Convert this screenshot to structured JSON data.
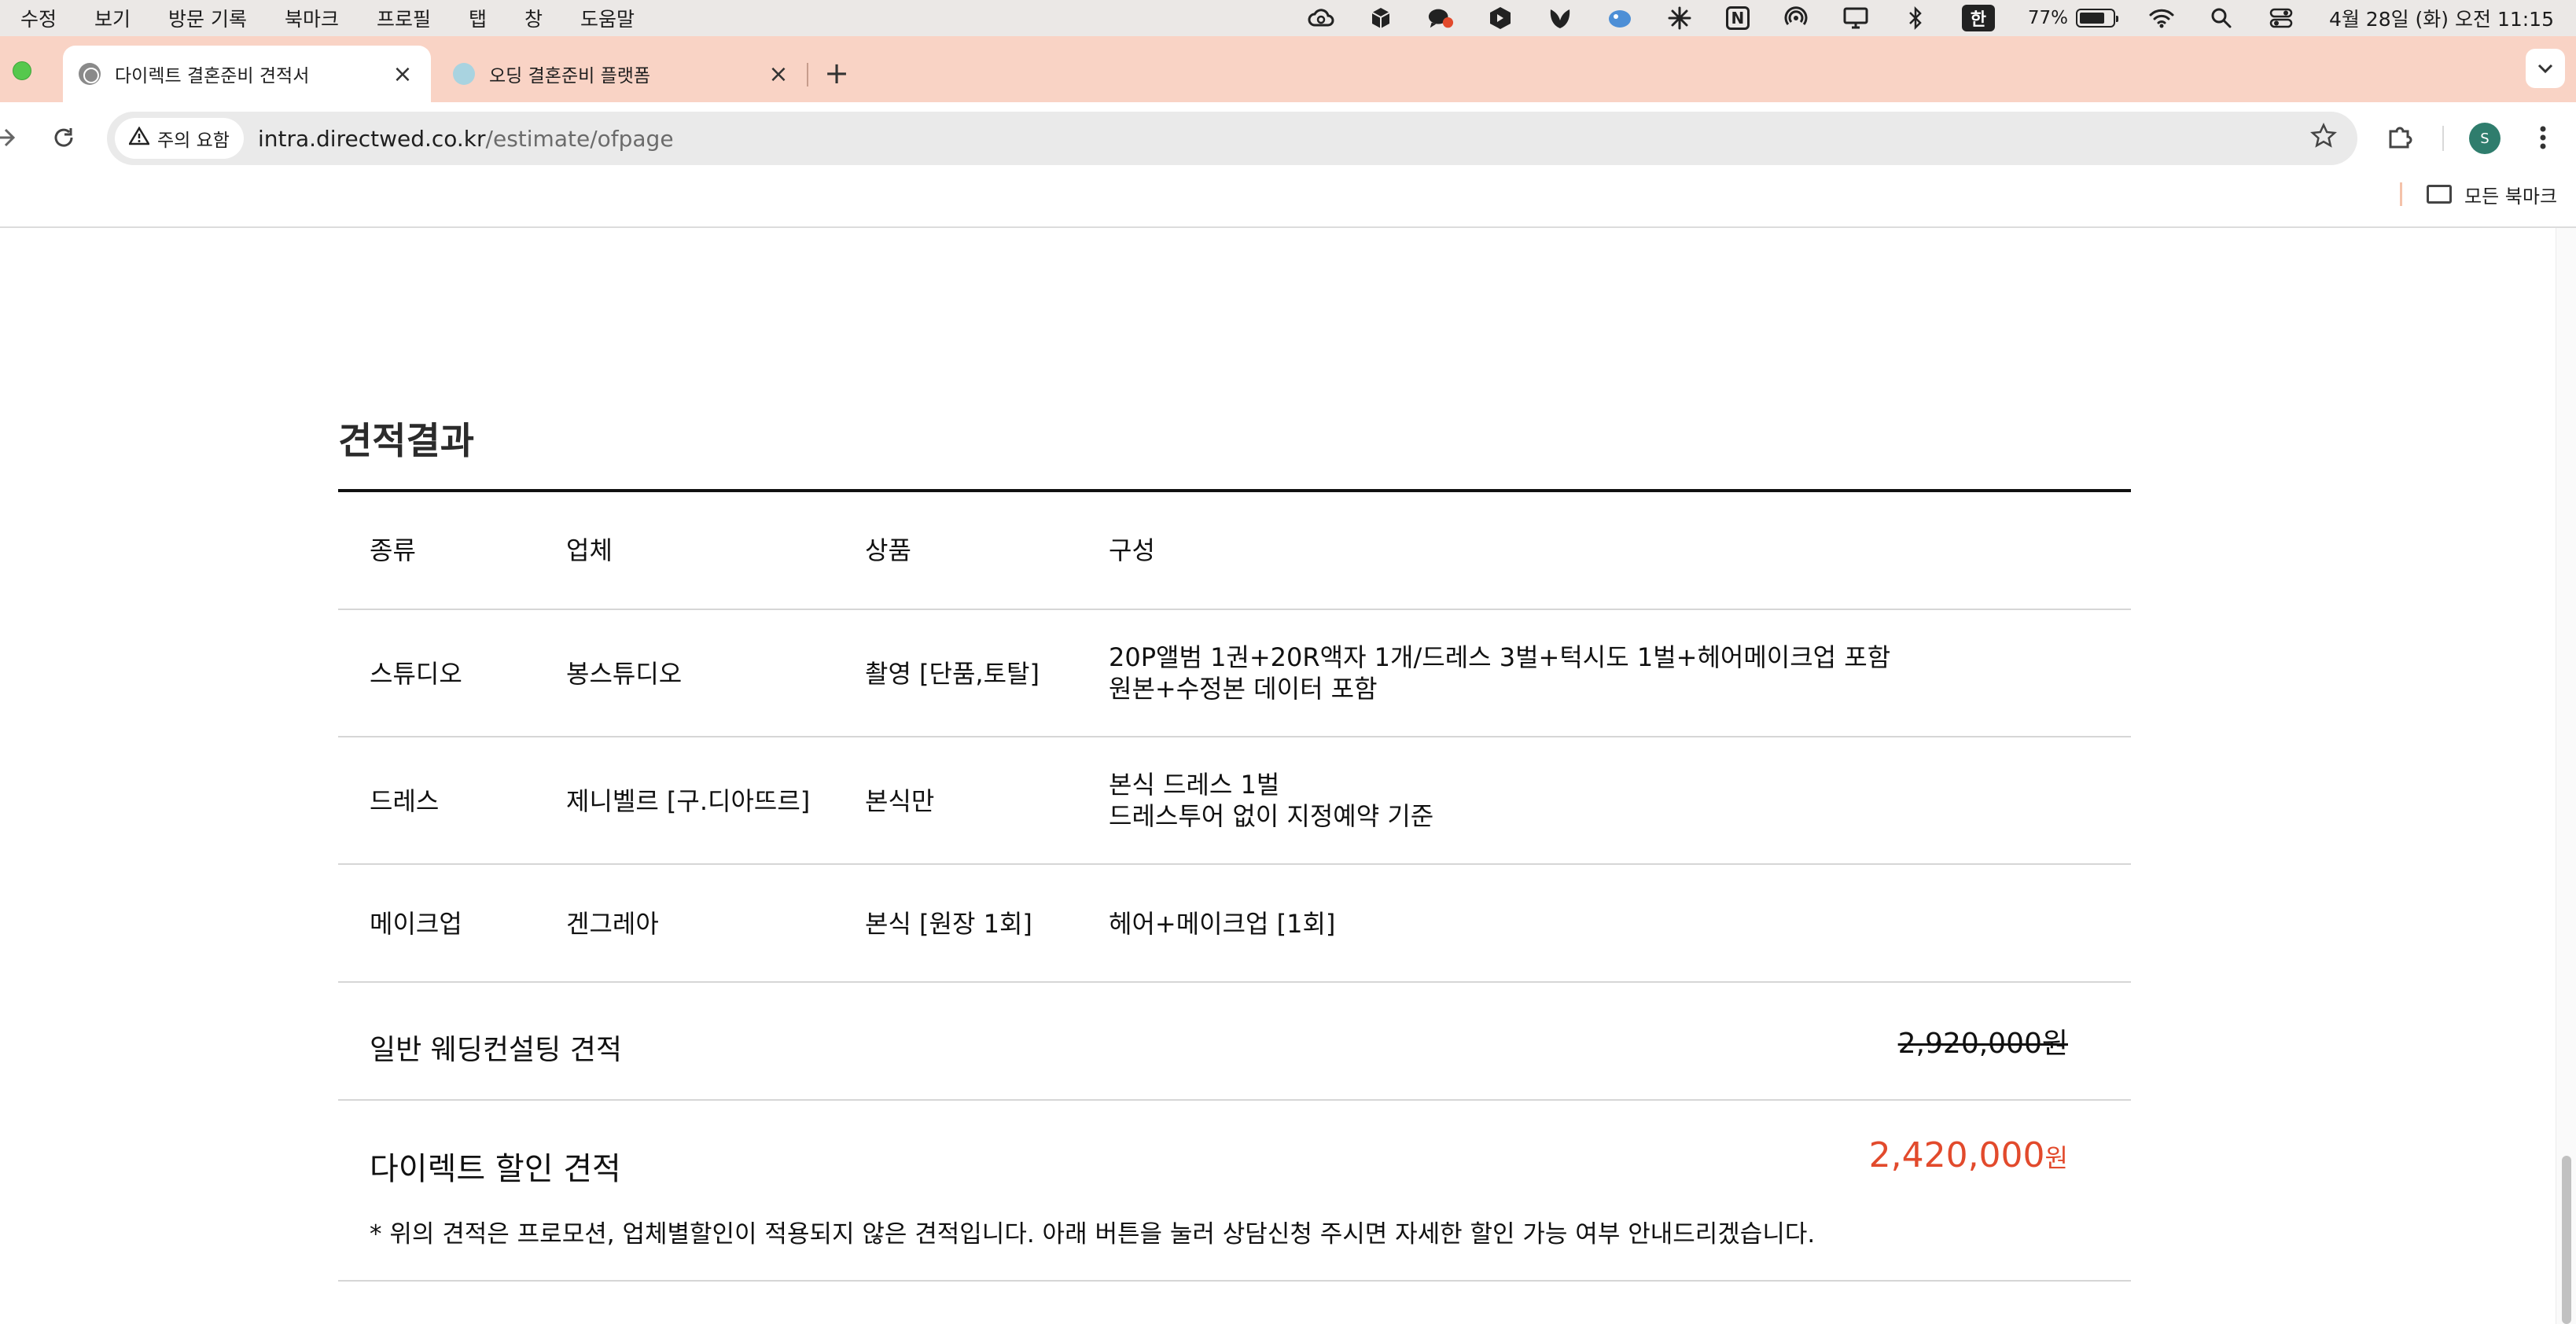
{
  "menubar": {
    "menus": [
      "수정",
      "보기",
      "방문 기록",
      "북마크",
      "프로필",
      "탭",
      "창",
      "도움말"
    ],
    "ime_label": "한",
    "notion_label": "N",
    "battery_pct": "77%",
    "battery_level": 0.77,
    "clock": "4월 28일 (화) 오전 11:15"
  },
  "tabs": [
    {
      "title": "다이렉트 결혼준비 견적서",
      "active": true
    },
    {
      "title": "오딩 결혼준비 플랫폼",
      "active": false
    }
  ],
  "toolbar": {
    "security_chip": "주의 요함",
    "url_host": "intra.directwed.co.kr",
    "url_path": "/estimate/ofpage",
    "avatar_initial": "S"
  },
  "bookmarks": {
    "all_bookmarks_label": "모든 북마크"
  },
  "estimate": {
    "title": "견적결과",
    "columns": [
      "종류",
      "업체",
      "상품",
      "구성"
    ],
    "rows": [
      {
        "type": "스튜디오",
        "vendor": "봉스튜디오",
        "product": "촬영 [단품,토탈]",
        "config_line1": "20P앨범 1권+20R액자 1개/드레스 3벌+턱시도 1벌+헤어메이크업 포함",
        "config_line2": "원본+수정본 데이터 포함"
      },
      {
        "type": "드레스",
        "vendor": "제니벨르 [구.디아뜨르]",
        "product": "본식만",
        "config_line1": "본식 드레스 1벌",
        "config_line2": "드레스투어 없이 지정예약 기준"
      },
      {
        "type": "메이크업",
        "vendor": "겐그레아",
        "product": "본식 [원장 1회]",
        "config_line1": "헤어+메이크업 [1회]",
        "config_line2": ""
      }
    ],
    "general_label": "일반 웨딩컨설팅 견적",
    "general_price": "2,920,000원",
    "discount_label": "다이렉트 할인 견적",
    "discount_price": "2,420,000",
    "discount_unit": "원",
    "note": "* 위의 견적은 프로모션, 업체별할인이 적용되지 않은 견적입니다. 아래 버튼을 눌러 상담신청 주시면 자세한 할인 가능 여부 안내드리겠습니다.",
    "accent_color": "#e24a2c"
  }
}
